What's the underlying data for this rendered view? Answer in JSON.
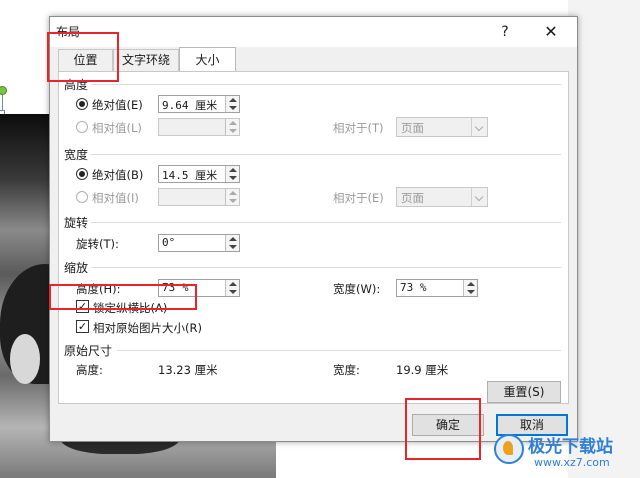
{
  "dialog": {
    "title": "布局",
    "help": "?",
    "close": "✕"
  },
  "tabs": [
    {
      "label": "位置"
    },
    {
      "label": "文字环绕"
    },
    {
      "label": "大小"
    }
  ],
  "height_section": {
    "title": "高度",
    "absolute_label": "绝对值(E)",
    "absolute_value": "9.64 厘米",
    "relative_label": "相对值(L)",
    "relative_to_label": "相对于(T)",
    "relative_to_value": "页面"
  },
  "width_section": {
    "title": "宽度",
    "absolute_label": "绝对值(B)",
    "absolute_value": "14.5 厘米",
    "relative_label": "相对值(I)",
    "relative_to_label": "相对于(E)",
    "relative_to_value": "页面"
  },
  "rotate_section": {
    "title": "旋转",
    "rotate_label": "旋转(T):",
    "rotate_value": "0°"
  },
  "scale_section": {
    "title": "缩放",
    "height_label": "高度(H):",
    "height_value": "73 %",
    "width_label": "宽度(W):",
    "width_value": "73 %",
    "lock_label": "锁定纵横比(A)",
    "relative_original_label": "相对原始图片大小(R)"
  },
  "original_section": {
    "title": "原始尺寸",
    "height_label": "高度:",
    "height_value": "13.23 厘米",
    "width_label": "宽度:",
    "width_value": "19.9 厘米"
  },
  "buttons": {
    "reset": "重置(S)",
    "ok": "确定",
    "cancel": "取消"
  },
  "watermark": {
    "text": "极光下载站",
    "url": "www.xz7.com"
  },
  "colors": {
    "highlight_red": "#e8262a",
    "focus_blue": "#0078d7"
  }
}
